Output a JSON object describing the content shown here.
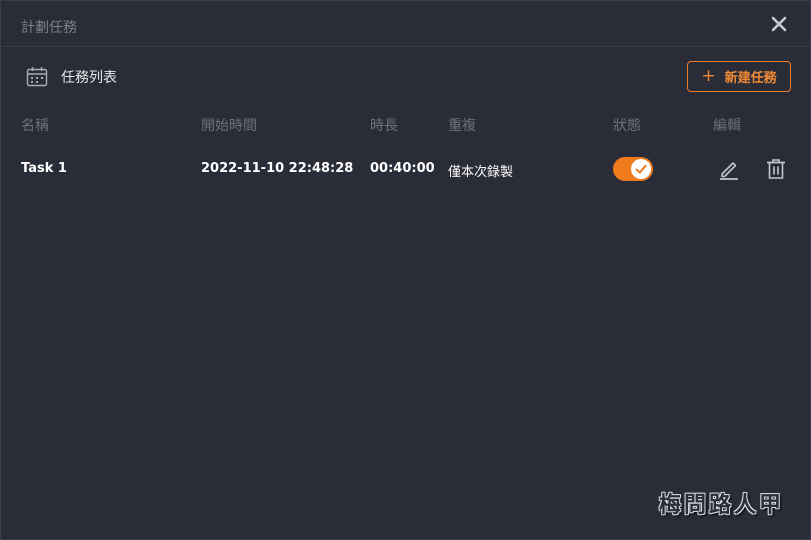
{
  "window": {
    "title": "計劃任務"
  },
  "toolbar": {
    "list_label": "任務列表",
    "new_task_plus": "+",
    "new_task_label": "新建任務"
  },
  "table": {
    "columns": [
      "名稱",
      "開始時間",
      "時長",
      "重複",
      "狀態",
      "編輯"
    ],
    "rows": [
      {
        "name": "Task 1",
        "start_time": "2022-11-10 22:48:28",
        "duration": "00:40:00",
        "repeat": "僅本次錄製",
        "enabled": true
      }
    ]
  },
  "watermark": "梅問路人甲",
  "colors": {
    "accent": "#f07b1d",
    "background": "#2a2c37",
    "muted_text": "#6d717d"
  },
  "icons": {
    "close": "close-icon",
    "calendar": "calendar-icon",
    "toggle_check": "check-icon",
    "edit": "pencil-icon",
    "delete": "trash-icon"
  }
}
